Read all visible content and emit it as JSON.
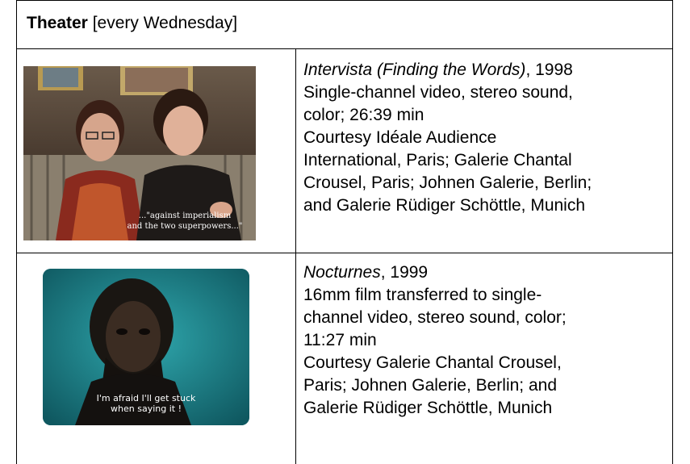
{
  "heading": {
    "bold": "Theater",
    "rest": " [every Wednesday]"
  },
  "rows": [
    {
      "image": {
        "subject": "two-people-seated-video-still",
        "subtitle_lines": [
          "...\"against imperialism",
          "and the two superpowers...\""
        ]
      },
      "title": "Intervista (Finding the Words)",
      "year": ", 1998",
      "lines": [
        "Single-channel video, stereo sound,",
        "color; 26:39 min",
        "Courtesy Idéale Audience",
        "International, Paris; Galerie Chantal",
        "Crousel, Paris; Johnen Galerie, Berlin;",
        "and Galerie Rüdiger Schöttle, Munich"
      ]
    },
    {
      "image": {
        "subject": "man-portrait-cyan-video-still",
        "subtitle_lines": [
          "I'm afraid I'll get stuck",
          "when saying it !"
        ]
      },
      "title": "Nocturnes",
      "year": ", 1999",
      "lines": [
        "16mm film transferred to single-",
        "channel video, stereo sound, color;",
        "11:27 min",
        "Courtesy Galerie Chantal Crousel,",
        "Paris; Johnen Galerie, Berlin; and",
        "Galerie Rüdiger Schöttle, Munich"
      ]
    }
  ]
}
